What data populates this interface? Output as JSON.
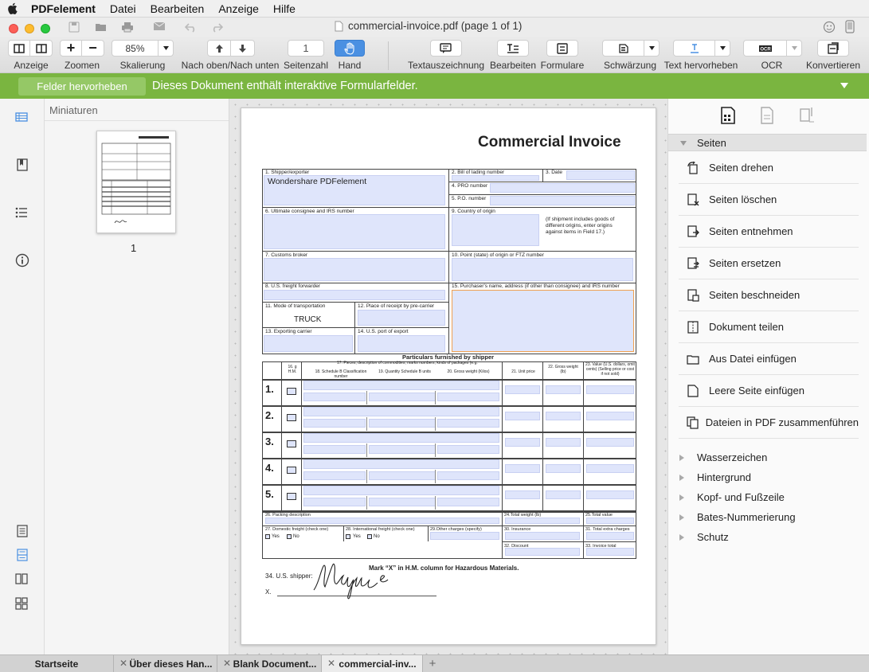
{
  "menubar": {
    "app": "PDFelement",
    "items": [
      "Datei",
      "Bearbeiten",
      "Anzeige",
      "Hilfe"
    ]
  },
  "window": {
    "title": "commercial-invoice.pdf (page 1 of 1)"
  },
  "toolbar": {
    "zoom_value": "85%",
    "page_number": "1",
    "labels": {
      "anzeige": "Anzeige",
      "zoomen": "Zoomen",
      "skalierung": "Skalierung",
      "nav": "Nach oben/Nach unten",
      "seitenzahl": "Seitenzahl",
      "hand": "Hand",
      "textauszeichnung": "Textauszeichnung",
      "bearbeiten": "Bearbeiten",
      "formulare": "Formulare",
      "schwaerzung": "Schwärzung",
      "text_hervorheben": "Text hervorheben",
      "ocr": "OCR",
      "konvertieren": "Konvertieren"
    },
    "accent": "#4a90e2"
  },
  "notice": {
    "button": "Felder hervorheben",
    "text": "Dieses Dokument enthält interaktive Formularfelder.",
    "color": "#7ab540"
  },
  "thumbnails": {
    "header": "Miniaturen",
    "page_label": "1"
  },
  "document": {
    "title": "Commercial Invoice",
    "f1": "1. Shipper/exporter",
    "shipper": "Wondershare PDFelement",
    "f2": "2. Bill of lading number",
    "f3": "3. Date",
    "f4": "4. PRO number",
    "f5": "5. P.O. number",
    "f6": "6. Ultimate consignee and IRS number",
    "f9": "9. Country of origin",
    "f9note": "(If shipment includes goods of different origins, enter origins against items in Field 17.)",
    "f7": "7. Customs broker",
    "f10": "10. Point (state) of origin or FTZ number",
    "f8": "8. U.S. freight forwarder",
    "f15": "15. Purchaser's name, address (if other than consignee) and IRS number",
    "f11": "11. Mode of transportation",
    "mode": "TRUCK",
    "f12": "12. Place of receipt by pre-carrier",
    "f13": "13. Exporting carrier",
    "f14": "14. U.S. port of export",
    "particulars": "Particulars furnished by shipper",
    "c17": "17. Pieces, description of commodities, marks numbers, kinds of packages (e.g.",
    "c16": "16. g H.M.",
    "c18": "18. Schedule B Classification number",
    "c19": "19. Quantity Schedule B units",
    "c20": "20. Gross weight (Kilos)",
    "c21": "21. Unit price",
    "c22": "22. Gross weight (lb)",
    "c23": "23. Value (U.S. dollars, omit cents) (Selling price or cost if not sold)",
    "rows": [
      "1.",
      "2.",
      "3.",
      "4.",
      "5."
    ],
    "f26": "26. Packing description",
    "f24": "24.Total weight (lb)",
    "f25": "25.Total value",
    "f27": "27. Domestic freight (check one)",
    "f28": "28. International freight (check one)",
    "f29": "29.Other charges (specify)",
    "f30": "30. Insurance",
    "f31": "31. Total extra charges",
    "f32": "32. Discount",
    "f33": "33. Invoice total",
    "yes": "Yes",
    "no": "No",
    "hazard": "Mark “X” in H.M. column for Hazardous Materials.",
    "f34": "34. U.S. shipper:",
    "x": "X.",
    "signature": "Maggie"
  },
  "rightpanel": {
    "section": "Seiten",
    "items": [
      "Seiten drehen",
      "Seiten löschen",
      "Seiten entnehmen",
      "Seiten ersetzen",
      "Seiten beschneiden",
      "Dokument teilen",
      "Aus Datei einfügen",
      "Leere Seite einfügen",
      "Dateien in PDF zusammenführen"
    ],
    "collapsed": [
      "Wasserzeichen",
      "Hintergrund",
      "Kopf- und Fußzeile",
      "Bates-Nummerierung",
      "Schutz"
    ]
  },
  "tabs": [
    {
      "label": "Startseite"
    },
    {
      "label": "Über dieses Han..."
    },
    {
      "label": "Blank Document..."
    },
    {
      "label": "commercial-inv..."
    }
  ],
  "new_tab": "+"
}
